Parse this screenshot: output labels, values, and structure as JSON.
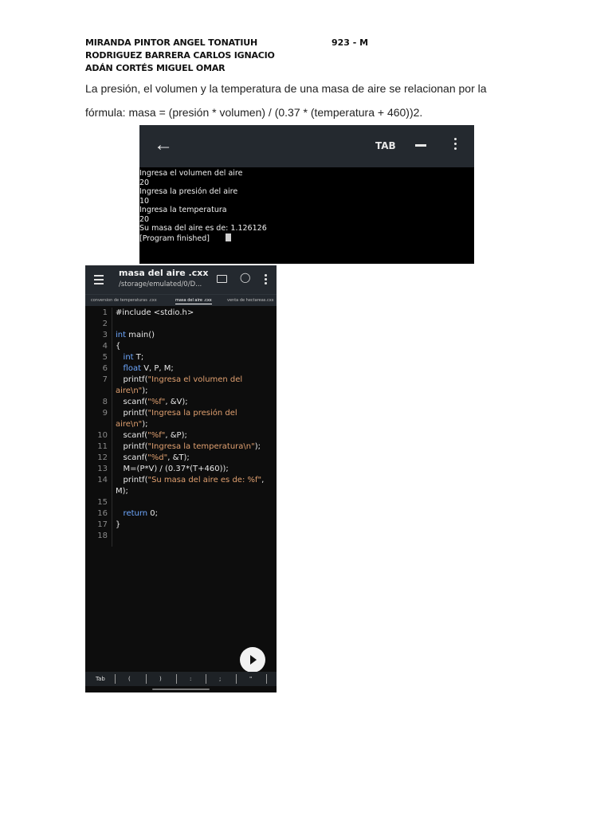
{
  "header": {
    "authors": [
      "MIRANDA PINTOR ANGEL TONATIUH",
      "RODRIGUEZ BARRERA CARLOS IGNACIO",
      "ADÁN CORTÉS MIGUEL OMAR"
    ],
    "group": "923 - M"
  },
  "paragraph": {
    "line1": "La presión, el volumen y la temperatura de una masa de aire se relacionan por la",
    "line2": "fórmula: masa = (presión * volumen) / (0.37 * (temperatura + 460))2."
  },
  "terminal": {
    "tab_label": "TAB",
    "output": [
      "Ingresa el volumen del aire",
      "20",
      "Ingresa la presión del aire",
      "10",
      "Ingresa la temperatura",
      "20",
      "Su masa del aire es de: 1.126126",
      "[Program finished]"
    ]
  },
  "editor": {
    "file_title": "masa del aire .cxx",
    "file_path": "/storage/emulated/0/D...",
    "tabs": [
      "conversion de temperaturas .cxx",
      "masa del aire .cxx",
      "venta de hectareas.cxx"
    ],
    "keys": [
      "Tab",
      "(",
      ")",
      ":",
      ";",
      "\""
    ],
    "code": {
      "l1": "#include <stdio.h>",
      "l3_kw": "int",
      "l3_rest": " main()",
      "l4": "{",
      "l5_kw": "int",
      "l5_rest": " T;",
      "l6_kw": "float",
      "l6_rest": " V, P, M;",
      "l7_a": "printf(",
      "l7_str": "\"Ingresa el volumen del",
      "l7b_str": "aire\\n\"",
      "l7b_rest": ");",
      "l8_a": "scanf(",
      "l8_str": "\"%f\"",
      "l8_rest": ", &V);",
      "l9_a": "printf(",
      "l9_str": "\"Ingresa la presión del",
      "l9b_str": "aire\\n\"",
      "l9b_rest": ");",
      "l10_a": "scanf(",
      "l10_str": "\"%f\"",
      "l10_rest": ", &P);",
      "l11_a": "printf(",
      "l11_str": "\"Ingresa la temperatura\\n\"",
      "l11_rest": ");",
      "l12_a": "scanf(",
      "l12_str": "\"%d\"",
      "l12_rest": ", &T);",
      "l13": "M=(P*V) / (0.37*(T+460));",
      "l14_a": "printf(",
      "l14_str": "\"Su masa del aire es de: %f\"",
      "l14_rest": ",",
      "l14b": "M);",
      "l16_kw": "return",
      "l16_rest": " 0;",
      "l17": "}"
    },
    "line_numbers": [
      "1",
      "2",
      "3",
      "4",
      "5",
      "6",
      "7",
      "8",
      "9",
      "10",
      "11",
      "12",
      "13",
      "14",
      "15",
      "16",
      "17",
      "18"
    ]
  }
}
